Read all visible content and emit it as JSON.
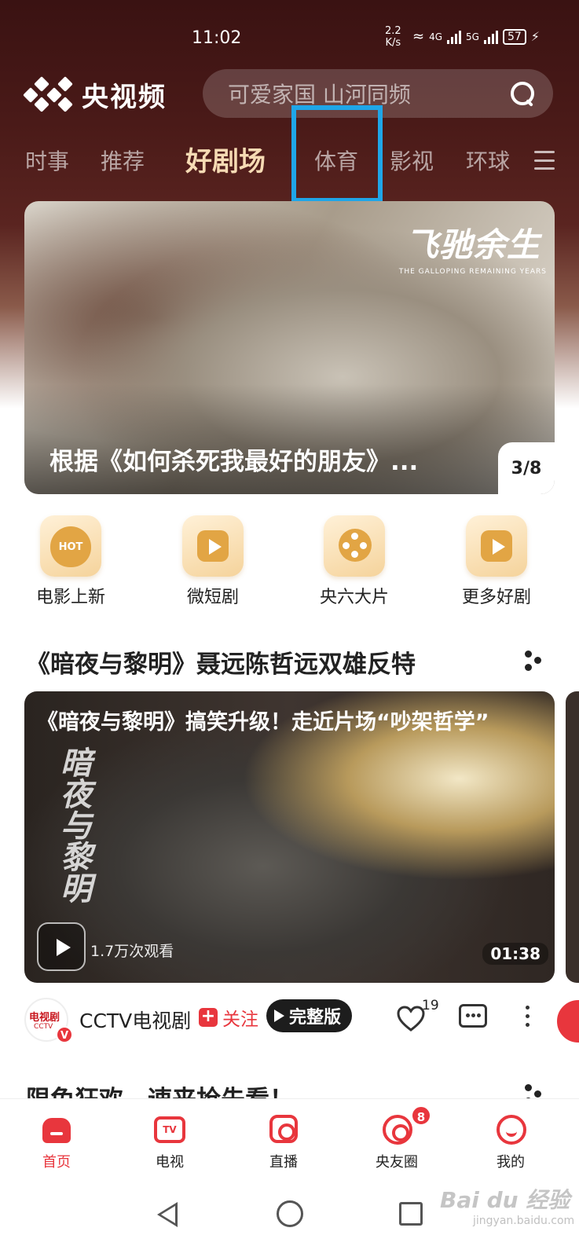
{
  "status_bar": {
    "time": "11:02",
    "speed_value": "2.2",
    "speed_unit": "K/s",
    "net1": "4G",
    "net2": "5G",
    "battery": "57"
  },
  "app": {
    "name": "央视频",
    "search_placeholder": "可爱家国 山河同频"
  },
  "tabs": [
    {
      "label": "时事",
      "active": false
    },
    {
      "label": "推荐",
      "active": false
    },
    {
      "label": "好剧场",
      "active": true
    },
    {
      "label": "体育",
      "active": false
    },
    {
      "label": "影视",
      "active": false
    },
    {
      "label": "环球",
      "active": false
    }
  ],
  "banner": {
    "logo_cn": "飞驰余生",
    "logo_en": "THE GALLOPING REMAINING YEARS",
    "title": "根据《如何杀死我最好的朋友》...",
    "pager": "3/8"
  },
  "quick_entries": [
    {
      "label": "电影上新",
      "icon": "hot-icon",
      "icon_text": "HOT"
    },
    {
      "label": "微短剧",
      "icon": "video-play-icon"
    },
    {
      "label": "央六大片",
      "icon": "film-reel-icon"
    },
    {
      "label": "更多好剧",
      "icon": "folder-play-icon"
    }
  ],
  "section1": {
    "title": "《暗夜与黎明》聂远陈哲远双雄反特"
  },
  "video": {
    "title": "《暗夜与黎明》搞笑升级！走近片场“吵架哲学”",
    "calligraphy": "暗夜与黎明",
    "views": "1.7万次观看",
    "duration": "01:38"
  },
  "author": {
    "avatar_text": "电视剧",
    "avatar_sub": "CCTV",
    "verified": "V",
    "name": "CCTV电视剧",
    "follow_label": "关注",
    "follow_plus": "+",
    "full_version_label": "完整版",
    "like_count": "19"
  },
  "section2": {
    "title": "限免狂欢，速来抢先看！"
  },
  "bottom_nav": [
    {
      "label": "首页",
      "icon": "home-icon",
      "active": true
    },
    {
      "label": "电视",
      "icon": "tv-icon",
      "icon_text": "TV",
      "active": false
    },
    {
      "label": "直播",
      "icon": "live-icon",
      "active": false
    },
    {
      "label": "央友圈",
      "icon": "circle-icon",
      "badge": "8",
      "active": false
    },
    {
      "label": "我的",
      "icon": "profile-icon",
      "active": false
    }
  ],
  "watermark": {
    "text": "Bai du 经验",
    "sub": "jingyan.baidu.com"
  },
  "colors": {
    "accent": "#e8363d",
    "tab_active": "#f6dbb4",
    "highlight_box": "#1fa6e8",
    "header_bg": "#3a1212"
  }
}
